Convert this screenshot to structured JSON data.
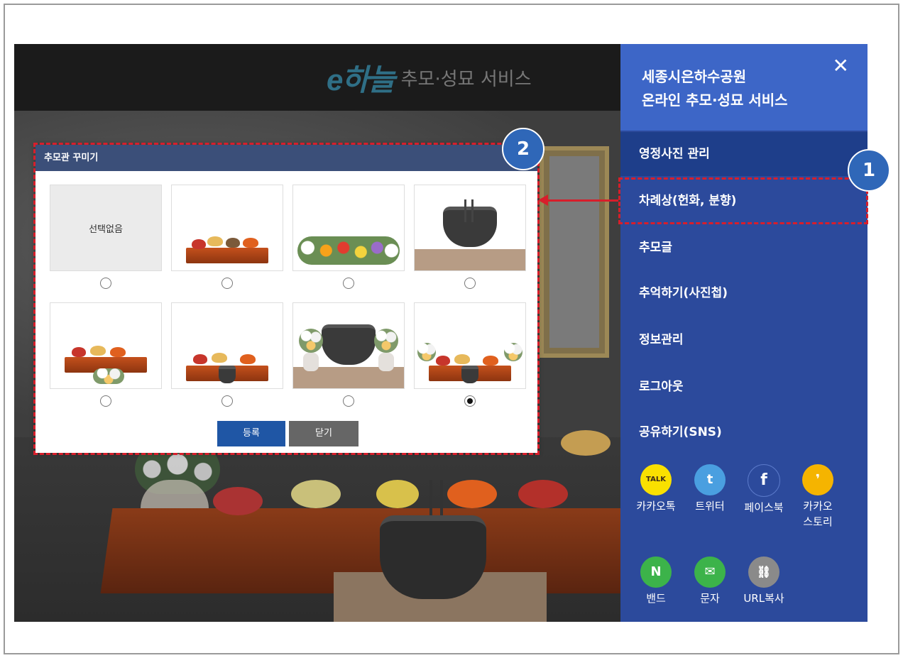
{
  "header": {
    "logo_mark": "e하늘",
    "service_title": "추모·성묘 서비스"
  },
  "modal": {
    "title": "추모관 꾸미기",
    "none_label": "선택없음",
    "options": [
      {
        "name": "none",
        "selected": false
      },
      {
        "name": "table-food",
        "selected": false
      },
      {
        "name": "flowers",
        "selected": false
      },
      {
        "name": "incense-pot",
        "selected": false
      },
      {
        "name": "table-food-flowers",
        "selected": false
      },
      {
        "name": "table-food-incense",
        "selected": false
      },
      {
        "name": "incense-pot-flowers",
        "selected": false
      },
      {
        "name": "table-food-incense-flowers",
        "selected": true
      }
    ],
    "register_label": "등록",
    "close_label": "닫기"
  },
  "sidebar": {
    "title_line1": "세종시은하수공원",
    "title_line2": "온라인 추모·성묘 서비스",
    "close_symbol": "✕",
    "items": [
      {
        "label": "영정사진 관리",
        "active": true
      },
      {
        "label": "차례상(헌화, 분향)",
        "active": false
      },
      {
        "label": "추모글",
        "active": false
      },
      {
        "label": "추억하기(사진첩)",
        "active": false
      },
      {
        "label": "정보관리",
        "active": false
      },
      {
        "label": "로그아웃",
        "active": false
      },
      {
        "label": "공유하기(SNS)",
        "active": false
      }
    ],
    "sns": [
      {
        "label": "카카오톡",
        "icon": "kakaotalk-icon",
        "glyph": "TALK",
        "color": "#f9e000"
      },
      {
        "label": "트위터",
        "icon": "twitter-icon",
        "glyph": "t",
        "color": "#4a9fe0"
      },
      {
        "label": "페이스북",
        "icon": "facebook-icon",
        "glyph": "f",
        "color": "#2c4a9c"
      },
      {
        "label": "카카오",
        "label2": "스토리",
        "icon": "kakaostory-icon",
        "glyph": "❜",
        "color": "#f5b400"
      },
      {
        "label": "밴드",
        "icon": "band-icon",
        "glyph": "N",
        "color": "#3cb34a"
      },
      {
        "label": "문자",
        "icon": "message-icon",
        "glyph": "✉",
        "color": "#3cb34a"
      },
      {
        "label": "URL복사",
        "icon": "link-icon",
        "glyph": "⛓",
        "color": "#8a8a8a"
      }
    ]
  },
  "annotations": {
    "badge1": "1",
    "badge2": "2"
  },
  "colors": {
    "sidebar": "#2c4a9c",
    "sidebar_head": "#3d66c7",
    "annotation": "#d81e2b",
    "badge": "#2f67b8"
  }
}
